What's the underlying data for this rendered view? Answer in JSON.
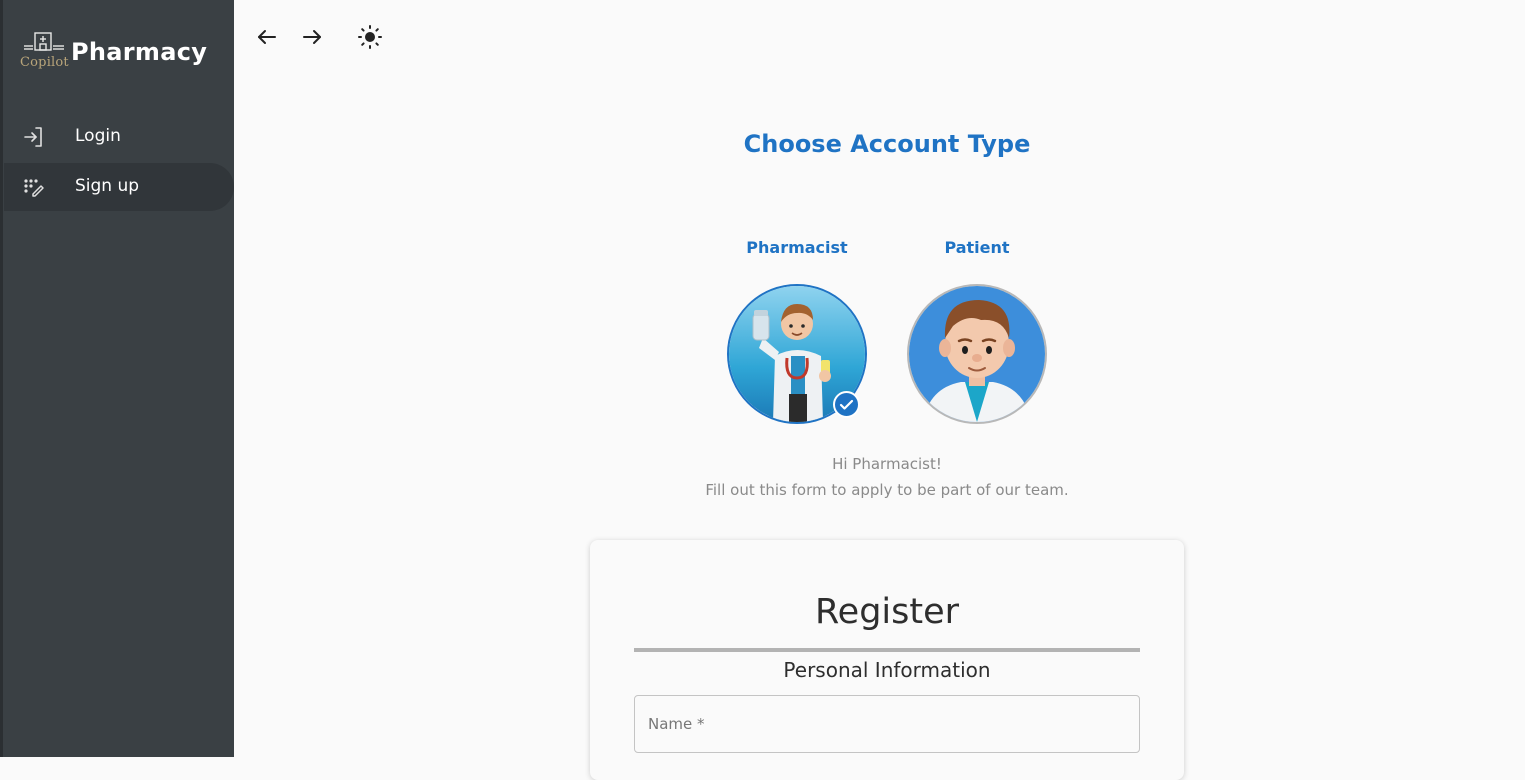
{
  "app": {
    "brand_small": "Copilot",
    "brand_title": "Pharmacy"
  },
  "sidebar": {
    "items": [
      {
        "label": "Login",
        "icon": "login-icon"
      },
      {
        "label": "Sign up",
        "icon": "signup-icon",
        "active": true
      }
    ]
  },
  "toolbar": {
    "back_icon": "arrow-left-icon",
    "forward_icon": "arrow-right-icon",
    "theme_icon": "sun-icon"
  },
  "main": {
    "heading": "Choose Account Type",
    "account_types": [
      {
        "label": "Pharmacist",
        "selected": true
      },
      {
        "label": "Patient",
        "selected": false
      }
    ],
    "greeting_line1": "Hi Pharmacist!",
    "greeting_line2": "Fill out this form to apply to be part of our team."
  },
  "form": {
    "title": "Register",
    "section": "Personal Information",
    "name_label": "Name *",
    "name_value": ""
  },
  "colors": {
    "sidebar_bg": "#3a4044",
    "accent": "#1f73c4",
    "page_bg": "#fafafa"
  }
}
